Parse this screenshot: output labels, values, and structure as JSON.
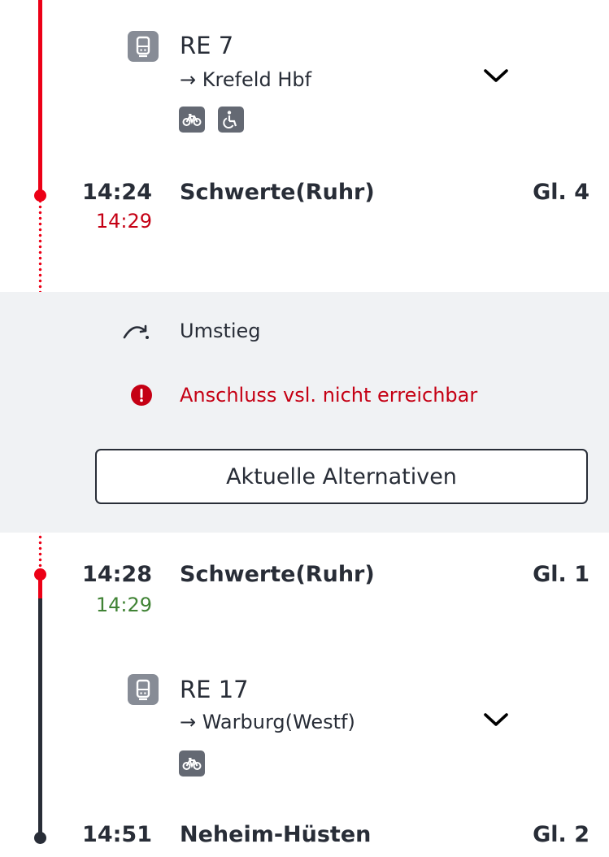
{
  "colors": {
    "accent_red": "#ec0016",
    "delay_red": "#c50014",
    "ontime_green": "#408335",
    "text_dark": "#282d37",
    "panel_bg": "#f0f2f4"
  },
  "leg1": {
    "train": "RE 7",
    "destination": "→ Krefeld Hbf",
    "features": [
      "bicycle-icon",
      "wheelchair-icon"
    ]
  },
  "stop1": {
    "time": "14:24",
    "realtime": "14:29",
    "station": "Schwerte(Ruhr)",
    "platform": "Gl. 4"
  },
  "transfer": {
    "label": "Umstieg",
    "warning": "Anschluss vsl. nicht erreichbar",
    "button": "Aktuelle Alternativen"
  },
  "stop2": {
    "time": "14:28",
    "realtime": "14:29",
    "station": "Schwerte(Ruhr)",
    "platform": "Gl. 1"
  },
  "leg2": {
    "train": "RE 17",
    "destination": "→ Warburg(Westf)",
    "features": [
      "bicycle-icon"
    ]
  },
  "stop3": {
    "time": "14:51",
    "station": "Neheim-Hüsten",
    "platform": "Gl. 2"
  }
}
